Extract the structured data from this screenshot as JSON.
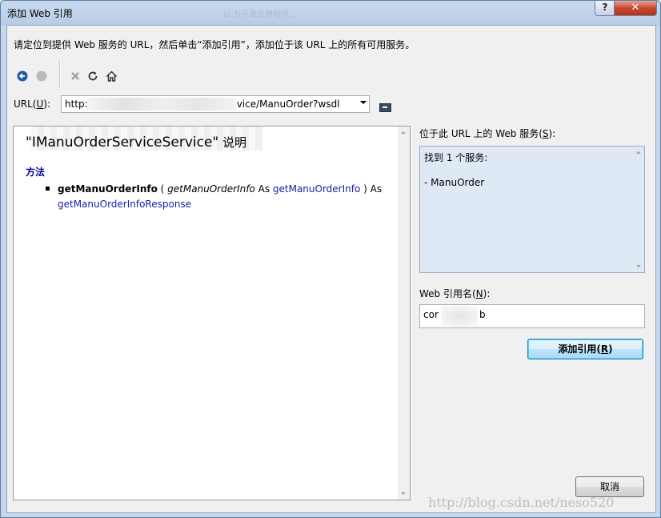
{
  "window": {
    "title": "添加 Web 引用",
    "help_label": "?",
    "close_label": "✕",
    "ghost_tab": "☑ 为开发应用程序..."
  },
  "instructions": "请定位到提供 Web 服务的 URL，然后单击“添加引用”，添加位于该 URL 上的所有可用服务。",
  "toolbar": {
    "buttons": [
      "back-icon",
      "forward-icon",
      "stop-icon",
      "refresh-icon",
      "home-icon"
    ]
  },
  "url": {
    "label_prefix": "URL(",
    "label_key": "U",
    "label_suffix": "):",
    "value_start": "http:",
    "value_end": "vice/ManuOrder?wsdl"
  },
  "doc": {
    "title_main": "\"IManuOrderServiceService\"",
    "title_suffix": " 说明",
    "methods_heading": "方法",
    "method": {
      "name": "getManuOrderInfo",
      "open": " ( ",
      "param": "getManuOrderInfo",
      "as1": " As ",
      "param_type": "getManuOrderInfo",
      "close": " ) As",
      "return_type": "getManuOrderInfoResponse"
    }
  },
  "services": {
    "label_prefix": "位于此 URL 上的 Web 服务(",
    "label_key": "S",
    "label_suffix": "):",
    "found": "找到 1 个服务:",
    "item": "- ManuOrder"
  },
  "ref_name": {
    "label_prefix": "Web 引用名(",
    "label_key": "N",
    "label_suffix": "):",
    "value_start": "cor",
    "value_end": "b"
  },
  "buttons": {
    "add_prefix": "添加引用(",
    "add_key": "R",
    "add_suffix": ")",
    "cancel": "取消"
  },
  "watermark": "http://blog.csdn.net/neso520"
}
